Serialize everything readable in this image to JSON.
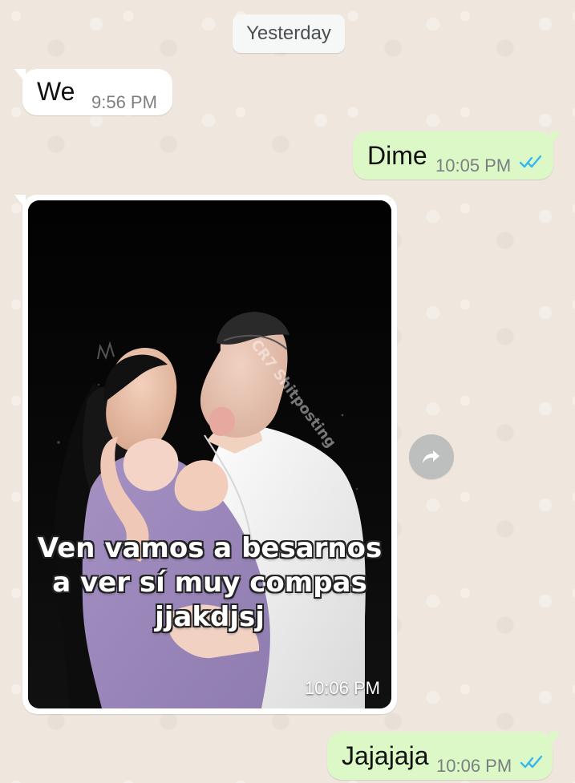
{
  "date_separator": "Yesterday",
  "messages": [
    {
      "text": "We",
      "time": "9:56 PM"
    },
    {
      "text": "Dime",
      "time": "10:05 PM"
    },
    {
      "media_caption": [
        "Ven vamos a besarnos",
        "a ver sí muy compas",
        "jjakdjsj"
      ],
      "watermark": "CR7 Shitposting",
      "time": "10:06 PM"
    },
    {
      "text": "Jajajaja",
      "time": "10:06 PM"
    }
  ],
  "colors": {
    "outgoing_bubble": "#dcf8c6",
    "incoming_bubble": "#ffffff",
    "read_ticks": "#34b7f1",
    "forward_button": "#bdbfbe"
  },
  "icons": {
    "forward": "forward-arrow-icon",
    "read_status": "double-check-icon"
  }
}
